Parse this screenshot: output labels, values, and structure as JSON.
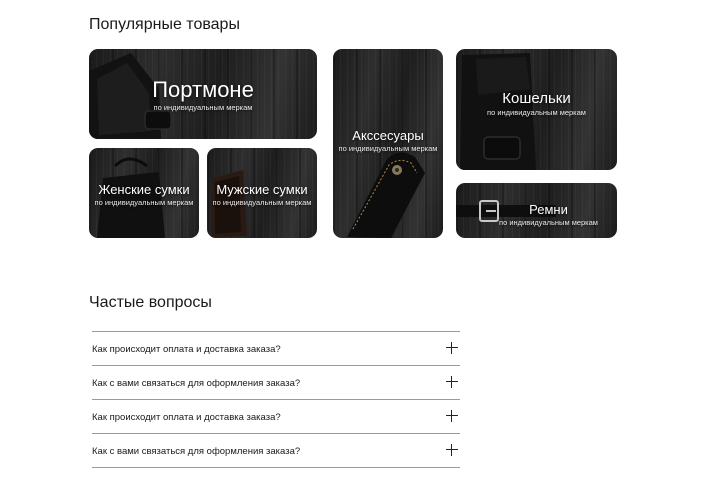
{
  "popular": {
    "title": "Популярные товары",
    "cards": [
      {
        "title": "Портмоне",
        "subtitle": "по индивидуальным меркам"
      },
      {
        "title": "Женские сумки",
        "subtitle": "по индивидуальным меркам"
      },
      {
        "title": "Мужские сумки",
        "subtitle": "по индивидуальным меркам"
      },
      {
        "title": "Акссесуары",
        "subtitle": "по индивидуальным меркам"
      },
      {
        "title": "Кошельки",
        "subtitle": "по индивидуальным меркам"
      },
      {
        "title": "Ремни",
        "subtitle": "по индивидуальным меркам"
      }
    ]
  },
  "faq": {
    "title": "Частые вопросы",
    "items": [
      {
        "question": "Как происходит оплата и доставка заказа?"
      },
      {
        "question": "Как с вами связаться для оформления заказа?"
      },
      {
        "question": "Как происходит оплата и доставка заказа?"
      },
      {
        "question": "Как с вами связаться для оформления заказа?"
      }
    ]
  }
}
